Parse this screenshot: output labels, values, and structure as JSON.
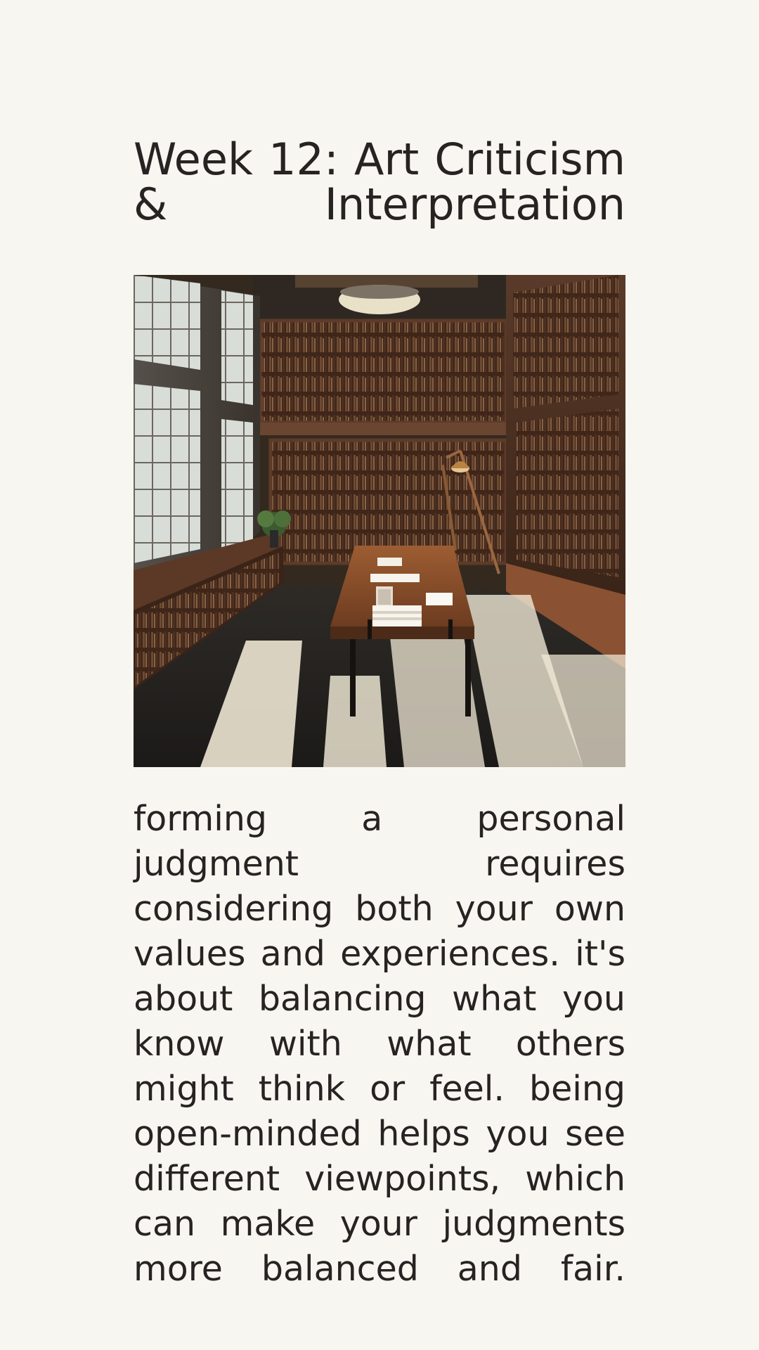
{
  "page": {
    "title": "Week 12: Art Criticism & Interpretation",
    "image": {
      "name": "library-reading-room-photo",
      "description_icon": "photo-icon"
    },
    "body_text": "forming a personal judgment requires considering both your own values and experiences. it's about balancing what you know with what others might think or feel. being open-minded helps you see different viewpoints, which can make your judgments more balanced and fair."
  },
  "colors": {
    "background": "#f8f6f1",
    "text": "#262322",
    "wood": "#7a4a2b",
    "floor": "#1f1d1b",
    "light": "#f2ead7"
  }
}
